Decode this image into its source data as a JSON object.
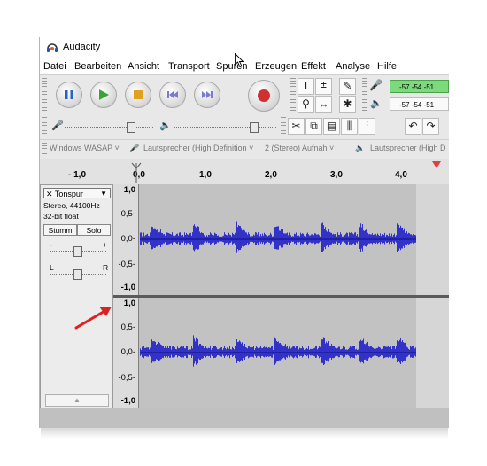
{
  "window": {
    "title": "Audacity"
  },
  "menu": [
    "Datei",
    "Bearbeiten",
    "Ansicht",
    "Transport",
    "Spuren",
    "Erzeugen",
    "Effekt",
    "Analyse",
    "Hilfe"
  ],
  "transport": {
    "buttons": [
      "pause-icon",
      "play-icon",
      "stop-icon",
      "skip-start-icon",
      "skip-end-icon",
      "record-icon"
    ]
  },
  "tools": [
    "ibeam-icon",
    "envelope-icon",
    "draw-icon",
    "zoom-icon",
    "timeshift-icon",
    "multi-icon"
  ],
  "meters": {
    "record": {
      "lr": "L\nR",
      "scale": "-57 -54 -51",
      "level_color": "#7cd97c"
    },
    "playback": {
      "lr": "L\nR",
      "scale": "-57 -54 -51"
    }
  },
  "devices": {
    "host": "Windows WASAP",
    "output": "Lautsprecher (High Definition",
    "channels": "2 (Stereo) Aufnah",
    "input": "Lautsprecher (High D"
  },
  "ruler": {
    "ticks": [
      "- 1,0",
      "0,0",
      "1,0",
      "2,0",
      "3,0",
      "4,0"
    ]
  },
  "track": {
    "name": "Tonspur",
    "format": "Stereo, 44100Hz",
    "bitdepth": "32-bit float",
    "mute": "Stumm",
    "solo": "Solo",
    "gain_minus": "-",
    "gain_plus": "+",
    "pan_left": "L",
    "pan_right": "R",
    "channel1_scale": [
      "1,0",
      "0,5-",
      "0,0-",
      "-0,5-",
      "-1,0"
    ],
    "channel2_scale": [
      "1,0",
      "0,5-",
      "0,0-",
      "-0,5-",
      "-1,0"
    ],
    "wave_color": "#3232c8"
  },
  "annotation": {
    "arrow_color": "#e02020"
  }
}
